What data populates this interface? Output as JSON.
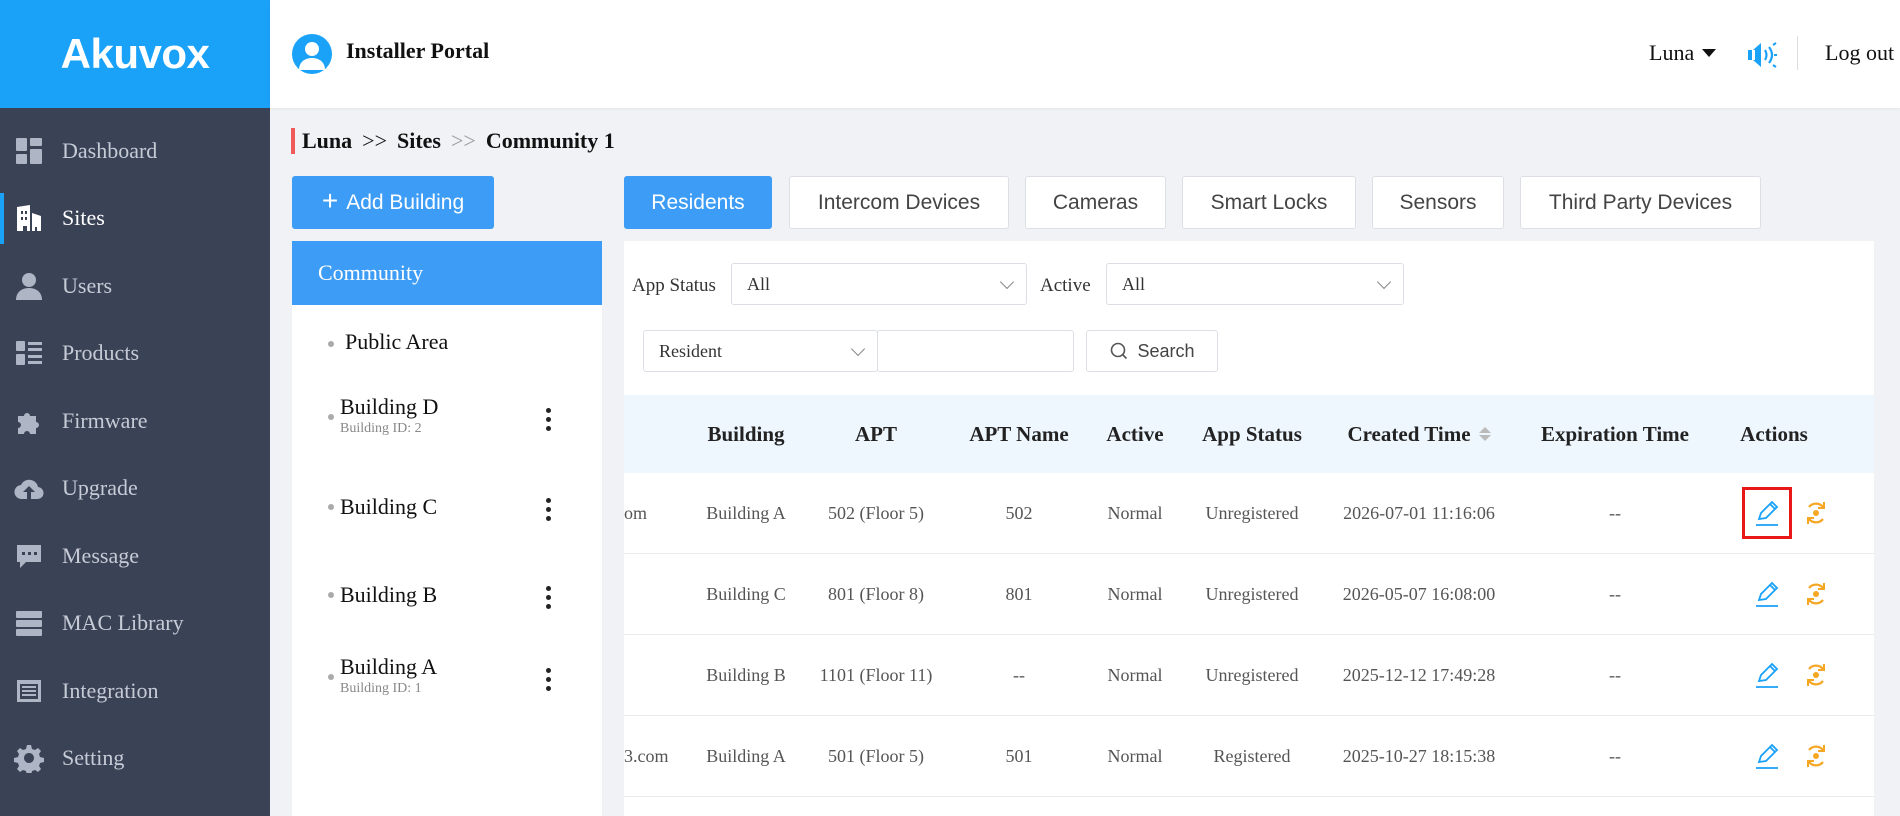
{
  "brand": {
    "logo_text": "Akuvox",
    "accent": "#1aa1f8"
  },
  "header": {
    "portal_title": "Installer Portal",
    "user_name": "Luna",
    "logout_label": "Log out"
  },
  "sidebar": {
    "items": [
      {
        "label": "Dashboard",
        "icon": "dashboard-icon"
      },
      {
        "label": "Sites",
        "icon": "building-icon",
        "active": true
      },
      {
        "label": "Users",
        "icon": "user-icon"
      },
      {
        "label": "Products",
        "icon": "list-icon"
      },
      {
        "label": "Firmware",
        "icon": "puzzle-icon"
      },
      {
        "label": "Upgrade",
        "icon": "cloud-upload-icon"
      },
      {
        "label": "Message",
        "icon": "chat-icon"
      },
      {
        "label": "MAC Library",
        "icon": "server-icon"
      },
      {
        "label": "Integration",
        "icon": "integration-icon"
      },
      {
        "label": "Setting",
        "icon": "gear-icon"
      }
    ]
  },
  "breadcrumb": {
    "items": [
      "Luna",
      "Sites",
      "Community 1"
    ],
    "separator": ">>"
  },
  "left_panel": {
    "add_button_label": "Add Building",
    "tree_title": "Community",
    "items": [
      {
        "name": "Public Area",
        "sub": ""
      },
      {
        "name": "Building D",
        "sub": "Building ID: 2"
      },
      {
        "name": "Building C",
        "sub": ""
      },
      {
        "name": "Building B",
        "sub": ""
      },
      {
        "name": "Building A",
        "sub": "Building ID: 1"
      }
    ]
  },
  "tabs": [
    {
      "label": "Residents",
      "active": true
    },
    {
      "label": "Intercom Devices"
    },
    {
      "label": "Cameras"
    },
    {
      "label": "Smart Locks"
    },
    {
      "label": "Sensors"
    },
    {
      "label": "Third Party Devices"
    }
  ],
  "filters": {
    "app_status_label": "App Status",
    "app_status_value": "All",
    "active_label": "Active",
    "active_value": "All",
    "search_type_value": "Resident",
    "search_query": "",
    "search_button_label": "Search"
  },
  "table": {
    "columns": [
      "Building",
      "APT",
      "APT Name",
      "Active",
      "App Status",
      "Created Time",
      "Expiration Time",
      "Actions"
    ],
    "rows": [
      {
        "email_fragment": "om",
        "building": "Building A",
        "apt": "502 (Floor 5)",
        "apt_name": "502",
        "active": "Normal",
        "app_status": "Unregistered",
        "created": "2026-07-01 11:16:06",
        "expiration": "--"
      },
      {
        "email_fragment": "",
        "building": "Building C",
        "apt": "801 (Floor 8)",
        "apt_name": "801",
        "active": "Normal",
        "app_status": "Unregistered",
        "created": "2026-05-07 16:08:00",
        "expiration": "--"
      },
      {
        "email_fragment": "",
        "building": "Building B",
        "apt": "1101 (Floor 11)",
        "apt_name": "--",
        "active": "Normal",
        "app_status": "Unregistered",
        "created": "2025-12-12 17:49:28",
        "expiration": "--"
      },
      {
        "email_fragment": "3.com",
        "building": "Building A",
        "apt": "501 (Floor 5)",
        "apt_name": "501",
        "active": "Normal",
        "app_status": "Registered",
        "created": "2025-10-27 18:15:38",
        "expiration": "--"
      }
    ],
    "action_icons": [
      "edit-icon",
      "reset-icon"
    ],
    "edit_color": "#1aa1f8",
    "reset_color": "#f5a623",
    "highlight_color": "#e81818"
  }
}
